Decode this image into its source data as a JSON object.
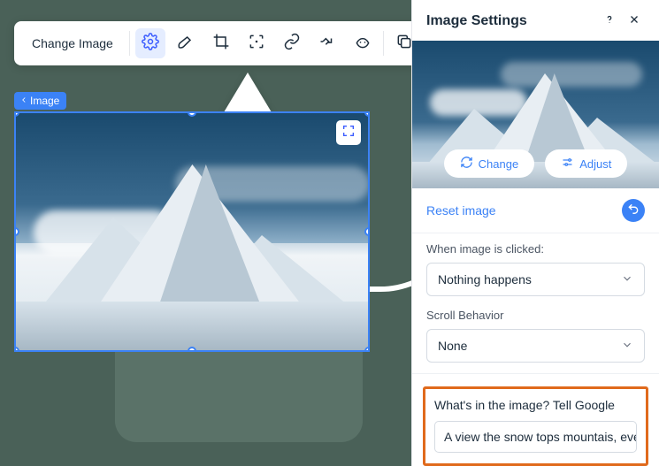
{
  "toolbar": {
    "change_image": "Change Image",
    "icons": {
      "settings": "gear-icon",
      "brush": "brush-icon",
      "crop": "crop-icon",
      "focal": "focal-point-icon",
      "link": "link-icon",
      "animation": "animation-icon",
      "mask": "mask-icon",
      "copy": "copy-icon"
    }
  },
  "breadcrumb": {
    "label": "Image"
  },
  "panel": {
    "title": "Image Settings",
    "change_btn": "Change",
    "adjust_btn": "Adjust",
    "reset_label": "Reset image",
    "click_behavior": {
      "label": "When image is clicked:",
      "value": "Nothing happens"
    },
    "scroll_behavior": {
      "label": "Scroll Behavior",
      "value": "None"
    },
    "alt": {
      "label": "What's in the image? Tell Google",
      "value": "A view the snow tops mountais, ever…"
    }
  },
  "colors": {
    "accent": "#3b82f6",
    "highlight": "#e06a1c"
  }
}
